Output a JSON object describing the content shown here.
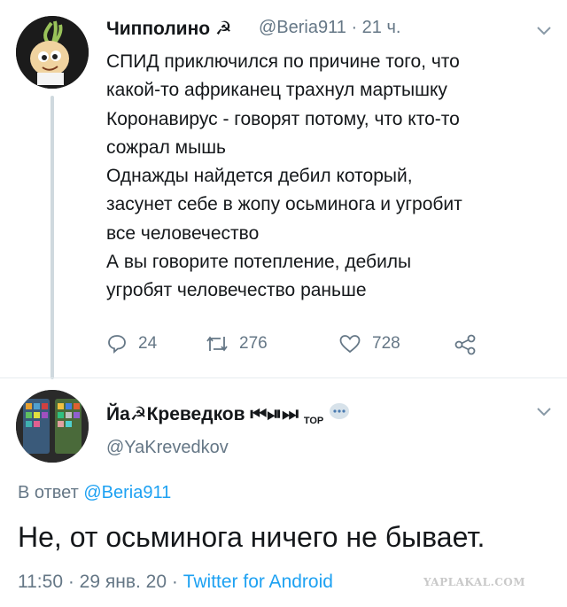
{
  "tweet1": {
    "author_name": "Чипполино ☭",
    "handle": "@Beria911",
    "time": "21 ч.",
    "lines": [
      "СПИД приключился  по причине того, что",
      "какой-то африканец трахнул мартышку",
      "Коронавирус - говорят потому, что кто-то",
      "сожрал мышь",
      "Однажды найдется дебил который,",
      "засунет себе в жопу осьминога и угробит",
      "все человечество",
      "А вы говорите потепление, дебилы",
      "угробят человечество раньше"
    ],
    "replies": "24",
    "retweets": "276",
    "likes": "728"
  },
  "tweet2": {
    "author_name": "Йа☭Креведков ⏮⏯⏭",
    "badge": "TOP",
    "handle": "@YaKrevedkov",
    "reply_prefix": "В ответ",
    "reply_handle": "@Beria911",
    "text": "Не, от осьминога ничего не бывает.",
    "time": "11:50",
    "date": "29 янв. 20",
    "source": "Twitter for Android"
  },
  "watermark": "YAPLAKAL.COM",
  "colors": {
    "link": "#1da1f2",
    "muted": "#657786",
    "line": "#cfd9de"
  }
}
